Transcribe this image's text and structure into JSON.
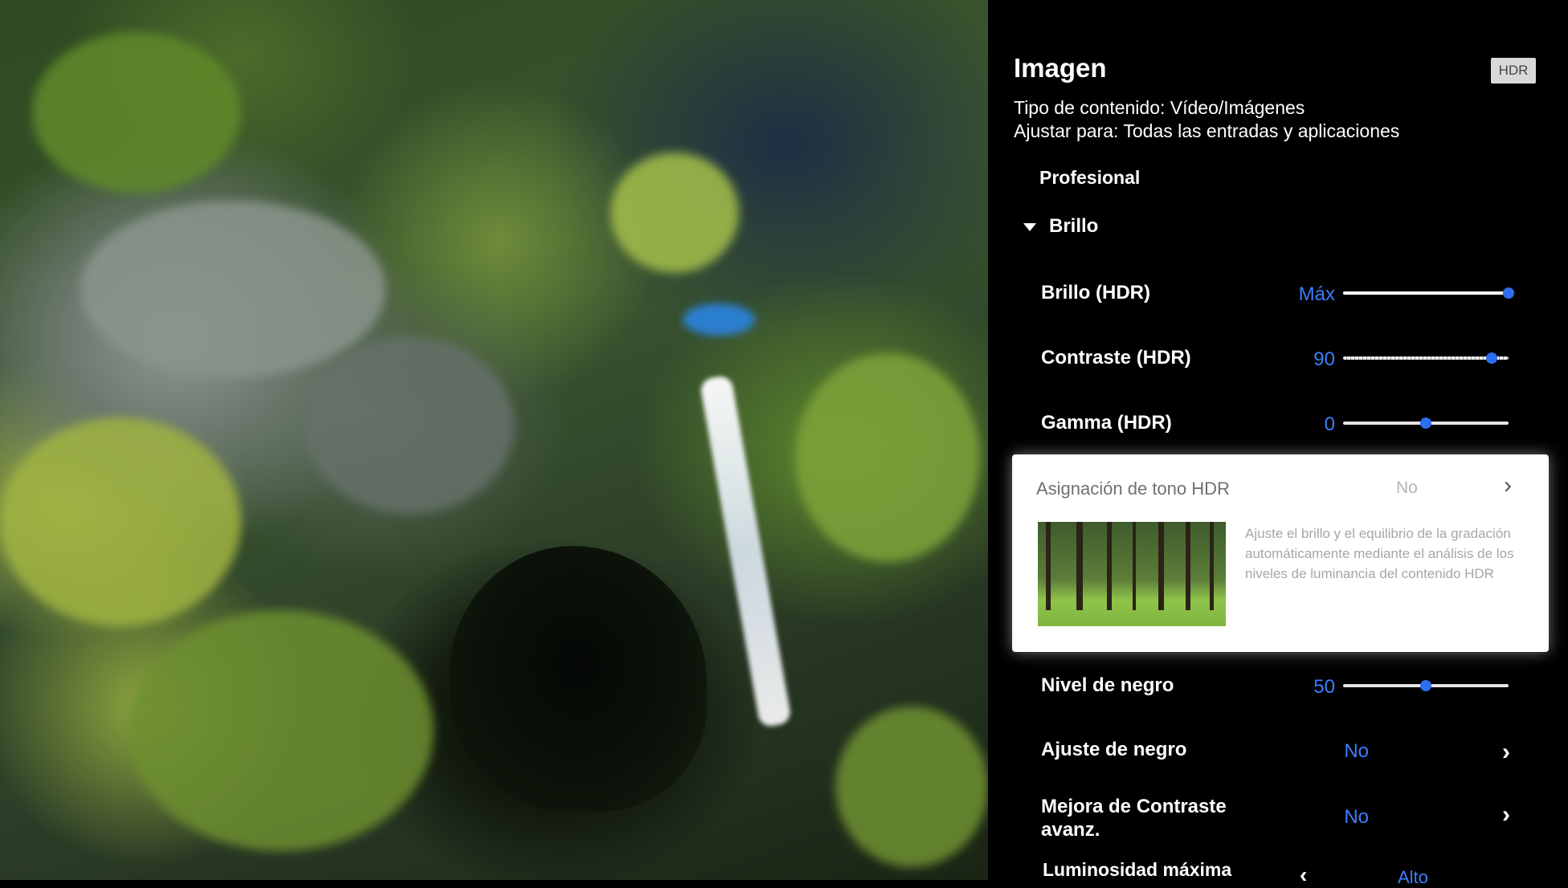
{
  "panel": {
    "title": "Imagen",
    "hdr_badge": "HDR",
    "content_type": "Tipo de contenido: Vídeo/Imágenes",
    "adjust_for": "Ajustar para: Todas las entradas y aplicaciones",
    "partial_label": "Profesional",
    "section": "Brillo"
  },
  "settings": [
    {
      "label": "Brillo (HDR)",
      "value": "Máx",
      "level": 1.0
    },
    {
      "label": "Contraste (HDR)",
      "value": "90",
      "level": 0.9
    },
    {
      "label": "Gamma (HDR)",
      "value": "0",
      "level": 0.5
    }
  ],
  "highlight": {
    "label": "Asignación de tono HDR",
    "value": "No",
    "description": "Ajuste el brillo y el equilibrio de la gradación automáticamente mediante el análisis de los niveles de luminancia del contenido HDR"
  },
  "lower_settings": {
    "black_level": {
      "label": "Nivel de negro",
      "value": "50",
      "level": 0.5
    },
    "black_adjust": {
      "label": "Ajuste de negro",
      "value": "No"
    },
    "contrast_enh": {
      "label": "Mejora de Contraste avanz.",
      "value": "No"
    },
    "peak_luminance": {
      "label": "Luminosidad máxima",
      "value": "Alto"
    }
  },
  "colors": {
    "accent": "#3d7dff",
    "thumb": "#2f6df0"
  }
}
